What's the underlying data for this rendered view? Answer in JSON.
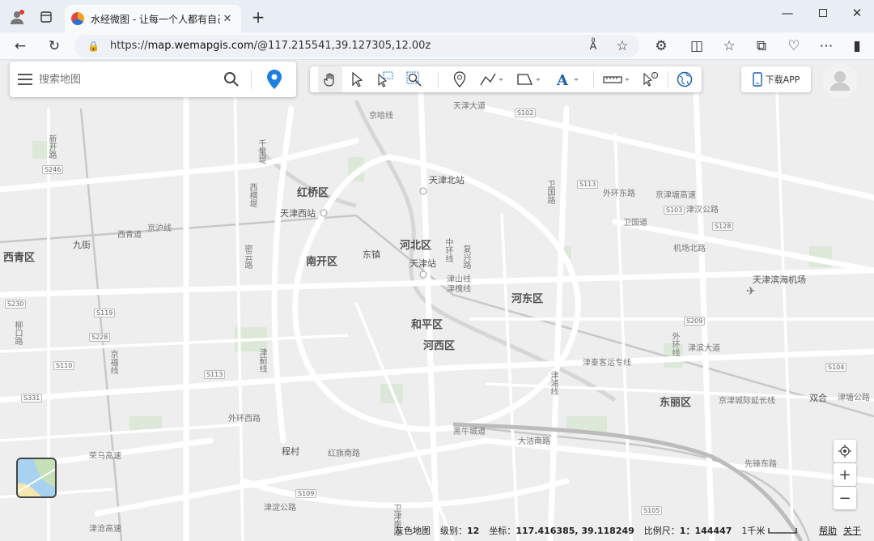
{
  "browser": {
    "tab_title": "水经微图 - 让每一个人都有自己的",
    "url_prefix": "https://",
    "url_host": "map.wemapgis.com",
    "url_path": "/@117.215541,39.127305,12.00z"
  },
  "search": {
    "placeholder": "搜索地图"
  },
  "app_button": "下载APP",
  "map_labels": {
    "districts": [
      "红桥区",
      "南开区",
      "河北区",
      "河东区",
      "和平区",
      "河西区",
      "西青区",
      "东丽区"
    ],
    "stations": [
      "天津北站",
      "天津西站",
      "天津站",
      "天津滨海机场"
    ],
    "places": [
      "九街",
      "东镇",
      "程村",
      "双合",
      "津槐线"
    ],
    "roads": [
      "西青道",
      "京沪线",
      "外环东路",
      "京津塘高速",
      "津汉公路",
      "卫国道",
      "机场北路",
      "津滨大道",
      "津秦客运专线",
      "京津城际延长线",
      "津塘公路",
      "黑牛城道",
      "大沽南路",
      "红旗南路",
      "外环西路",
      "津淀公路",
      "津沧高速",
      "荣乌高速",
      "先锋东路",
      "津山线",
      "天津大道",
      "京哈线"
    ],
    "vertical_roads": [
      "千里堤",
      "西横堤",
      "密云路",
      "中环线",
      "复兴路",
      "卫国路",
      "外环线",
      "卫津南路",
      "津浦线",
      "柳口路",
      "京福线",
      "津蓟线",
      "新开路"
    ],
    "shields": [
      "S246",
      "S102",
      "S113",
      "S103",
      "S128",
      "S230",
      "S119",
      "S228",
      "S110",
      "S113",
      "S331",
      "S109",
      "S105",
      "S209",
      "S104"
    ]
  },
  "status": {
    "layer": "灰色地图",
    "level_label": "级别：",
    "level_value": "12",
    "coord_label": "坐标：",
    "coord_value": "117.416385, 39.118249",
    "scale_label": "比例尺：",
    "scale_value": "1：144447",
    "scale_bar": "1千米"
  },
  "links": {
    "help": "帮助",
    "about": "关于"
  },
  "colors": {
    "accent": "#1a7fe0",
    "map_bg": "#eeeeee",
    "road": "#ffffff",
    "green": "#d7e8d3",
    "water": "#cfe3f2"
  },
  "zoom": {
    "plus": "+",
    "minus": "−"
  }
}
